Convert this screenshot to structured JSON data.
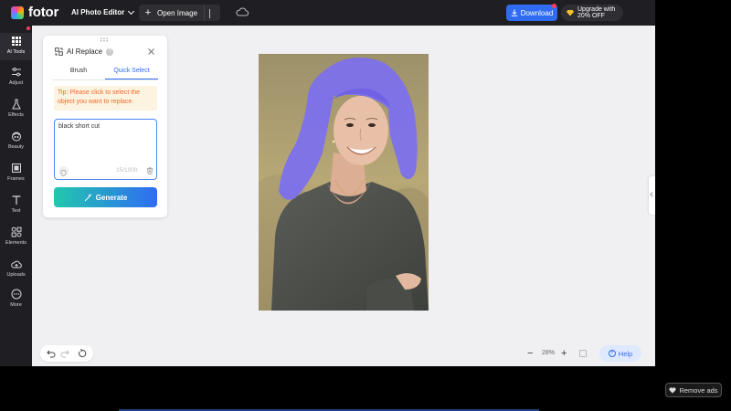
{
  "app": {
    "logo_text": "fotor",
    "editor_menu_label": "AI Photo Editor",
    "open_image_label": "Open Image",
    "download_label": "Download",
    "upgrade_label_line1": "Upgrade with",
    "upgrade_label_line2": "20% OFF"
  },
  "sidebar": {
    "items": [
      {
        "label": "AI Tools",
        "icon": "grid-icon",
        "active": true
      },
      {
        "label": "Adjust",
        "icon": "sliders-icon"
      },
      {
        "label": "Effects",
        "icon": "flask-icon"
      },
      {
        "label": "Beauty",
        "icon": "face-icon"
      },
      {
        "label": "Frames",
        "icon": "frame-icon"
      },
      {
        "label": "Text",
        "icon": "text-icon"
      },
      {
        "label": "Elements",
        "icon": "shapes-icon"
      },
      {
        "label": "Uploads",
        "icon": "cloud-upload-icon"
      },
      {
        "label": "More",
        "icon": "more-icon"
      }
    ]
  },
  "ai_panel": {
    "title": "AI Replace",
    "tabs": [
      {
        "label": "Brush",
        "active": false
      },
      {
        "label": "Quick Select",
        "active": true
      }
    ],
    "tip": "Tip: Please click to select the object you want to replace.",
    "prompt_value": "black short cut",
    "char_count": "15/1000",
    "generate_label": "Generate"
  },
  "zoom": {
    "minus": "−",
    "value": "28%",
    "plus": "+"
  },
  "help_label": "Help",
  "remove_ads_label": "Remove ads",
  "colors": {
    "accent": "#2f6cf3",
    "dark_bg": "#1f1f23",
    "canvas_bg": "#f0f0f2",
    "hair_mask": "#7b6ff0",
    "tip_text": "#f26b2a",
    "generate_gradient_start": "#22c8ad"
  }
}
